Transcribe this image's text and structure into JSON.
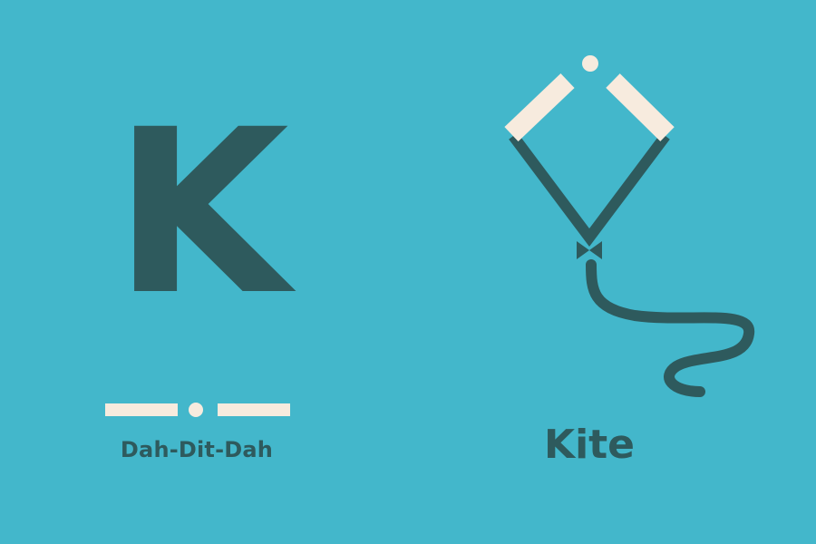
{
  "card": {
    "letter": "K",
    "morse_code": [
      "dash",
      "dot",
      "dash"
    ],
    "pronunciation": "Dah-Dit-Dah",
    "word": "Kite",
    "illustration": "kite-icon"
  },
  "colors": {
    "background": "#43b7cb",
    "dark": "#2e5a5d",
    "cream": "#f7ebde"
  }
}
